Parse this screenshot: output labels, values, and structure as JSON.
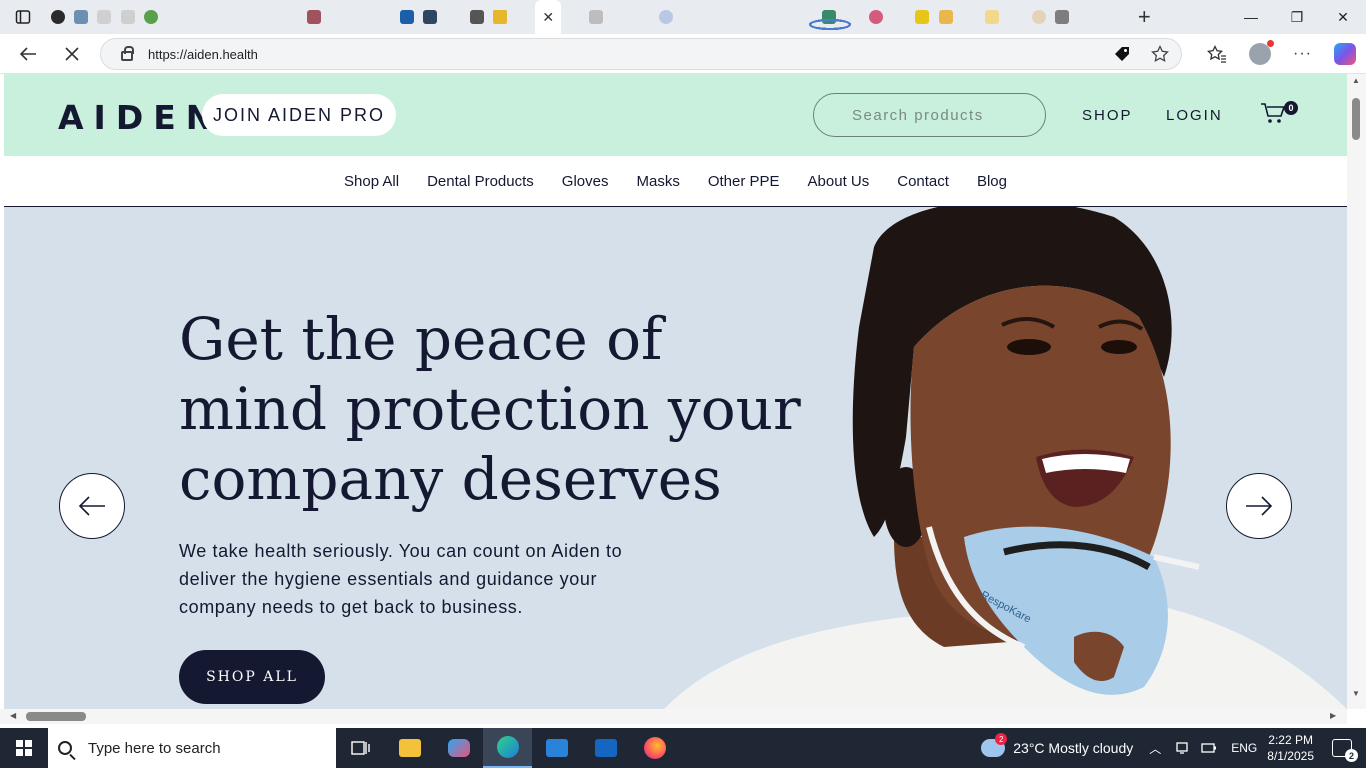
{
  "browser": {
    "url": "https://aiden.health"
  },
  "site": {
    "logo": "AIDEN",
    "join_pro": "JOIN AIDEN PRO",
    "search_placeholder": "Search products",
    "nav_shop": "SHOP",
    "nav_login": "LOGIN",
    "cart_count": "0",
    "categories": [
      "Shop All",
      "Dental Products",
      "Gloves",
      "Masks",
      "Other PPE",
      "About Us",
      "Contact",
      "Blog"
    ],
    "hero": {
      "title": "Get the peace of mind protection your company deserves",
      "text": "We take health seriously. You can count on Aiden to deliver the hygiene essentials and guidance your company needs to get back to business.",
      "button": "SHOP ALL",
      "mask_print": "RespoKare"
    },
    "colors": {
      "header_bg": "#c9f0dc",
      "navy": "#141831",
      "hero_bg": "#d6e0ea"
    }
  },
  "taskbar": {
    "search_placeholder": "Type here to search",
    "weather_badge": "2",
    "weather": "23°C  Mostly cloudy",
    "language": "ENG",
    "time": "2:22 PM",
    "date": "8/1/2025",
    "notifications": "2"
  }
}
